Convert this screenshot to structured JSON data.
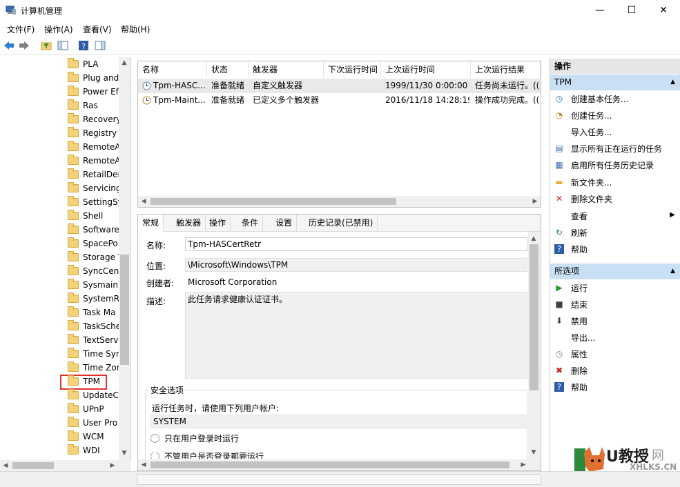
{
  "window": {
    "title": "计算机管理",
    "minimize": "—",
    "maximize": "☐",
    "close": "✕"
  },
  "menu": [
    "文件(F)",
    "操作(A)",
    "查看(V)",
    "帮助(H)"
  ],
  "tree": {
    "items": [
      "PLA",
      "Plug and",
      "Power Ef",
      "Ras",
      "Recovery",
      "Registry",
      "RemoteA",
      "RemoteA",
      "RetailDer",
      "Servicing",
      "SettingSy",
      "Shell",
      "Software",
      "SpacePo",
      "Storage T",
      "SyncCent",
      "Sysmain",
      "SystemRe",
      "Task Ma",
      "TaskSche",
      "TextServi",
      "Time Syn",
      "Time Zor",
      "TPM",
      "UpdateC",
      "UPnP",
      "User Pro",
      "WCM",
      "WDI"
    ],
    "selected": "TPM"
  },
  "tasks": {
    "columns": [
      "名称",
      "状态",
      "触发器",
      "下次运行时间",
      "上次运行时间",
      "上次运行结果"
    ],
    "rows": [
      {
        "name": "Tpm-HASC...",
        "status": "准备就绪",
        "trigger": "自定义触发器",
        "next": "",
        "last": "1999/11/30 0:00:00",
        "result": "任务尚未运行。(("
      },
      {
        "name": "Tpm-Maint...",
        "status": "准备就绪",
        "trigger": "已定义多个触发器",
        "next": "",
        "last": "2016/11/18 14:28:19",
        "result": "操作成功完成。(("
      }
    ]
  },
  "detail": {
    "tabs": [
      "常规",
      "触发器",
      "操作",
      "条件",
      "设置",
      "历史记录(已禁用)"
    ],
    "name_label": "名称:",
    "name_value": "Tpm-HASCertRetr",
    "location_label": "位置:",
    "location_value": "\\Microsoft\\Windows\\TPM",
    "author_label": "创建者:",
    "author_value": "Microsoft Corporation",
    "desc_label": "描述:",
    "desc_value": "此任务请求健康认证证书。",
    "security_label": "安全选项",
    "run_as_label": "运行任务时，请使用下列用户帐户:",
    "run_as_value": "SYSTEM",
    "option1": "只在用户登录时运行",
    "option2": "不管用户是否登录都要运行"
  },
  "actions": {
    "header": "操作",
    "section1": "TPM",
    "items1": [
      "创建基本任务...",
      "创建任务...",
      "导入任务...",
      "显示所有正在运行的任务",
      "启用所有任务历史记录",
      "新文件夹...",
      "删除文件夹",
      "查看",
      "刷新",
      "帮助"
    ],
    "section2": "所选项",
    "items2": [
      "运行",
      "结束",
      "禁用",
      "导出...",
      "属性",
      "删除",
      "帮助"
    ]
  },
  "watermark": {
    "text1": "U教授",
    "text2": "XHLKS.CN",
    "text3": "网"
  },
  "colors": {
    "selection_border": "#e03030",
    "section_bg": "#c9dff3"
  }
}
